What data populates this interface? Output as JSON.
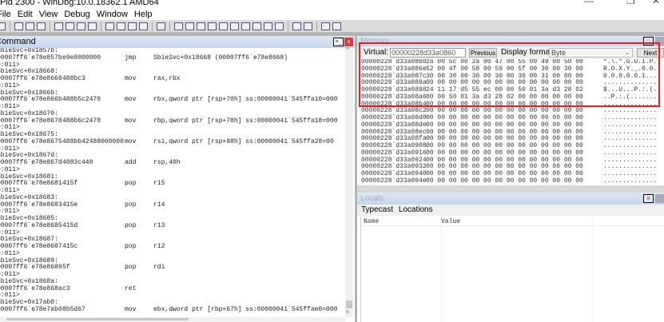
{
  "window": {
    "title": "Pid 2300 - WinDbg:10.0.18362.1 AMD64"
  },
  "menu": [
    "File",
    "Edit",
    "View",
    "Debug",
    "Window",
    "Help"
  ],
  "toolbar_icons": [
    "open-icon",
    "cut-icon",
    "copy-icon",
    "paste-icon",
    "step-into-source-icon",
    "step-over-source-icon",
    "stop-debugging-icon",
    "break-icon",
    "step-into-icon",
    "step-over-icon",
    "step-out-icon",
    "run-to-cursor-icon",
    "hand-icon",
    "command-window-icon",
    "watch-icon",
    "locals-icon",
    "registers-icon",
    "memory-icon",
    "call-stack-icon",
    "disassembly-icon",
    "scratch-pad-icon",
    "processes-icon",
    "command-browser-icon",
    "source-mode-icon",
    "hex-mode-icon",
    "font-icon",
    "options-icon"
  ],
  "command": {
    "title": "Command",
    "lines": [
      {
        "t": "l",
        "a": "SbieSvc+0x1857b:"
      },
      {
        "t": "i",
        "addr": "00007ff6`e78e857b",
        "bytes": "e9e8000000",
        "op": "jmp",
        "args": "SbieSvc+0x18668 (00007ff6`e78e8668)"
      },
      {
        "t": "p",
        "a": "0:011>"
      },
      {
        "t": "l",
        "a": "SbieSvc+0x18668:"
      },
      {
        "t": "i",
        "addr": "00007ff6`e78e8668",
        "bytes": "488bc3",
        "op": "mov",
        "args": "rax,rbx"
      },
      {
        "t": "p",
        "a": "0:011>"
      },
      {
        "t": "l",
        "a": "SbieSvc+0x1866b:"
      },
      {
        "t": "i",
        "addr": "00007ff6`e78e866b",
        "bytes": "488b5c2470",
        "op": "mov",
        "args": "rbx,qword ptr [rsp+70h] ss:00000041`545ffa10=000"
      },
      {
        "t": "p",
        "a": "0:011>"
      },
      {
        "t": "l",
        "a": "SbieSvc+0x18670:"
      },
      {
        "t": "i",
        "addr": "00007ff6`e78e8670",
        "bytes": "488b6c2478",
        "op": "mov",
        "args": "rbp,qword ptr [rsp+78h] ss:00000041`545ffa18=000"
      },
      {
        "t": "p",
        "a": "0:011>"
      },
      {
        "t": "l",
        "a": "SbieSvc+0x18675:"
      },
      {
        "t": "i",
        "addr": "00007ff6`e78e8675",
        "bytes": "488bb42488000000",
        "op": "mov",
        "args": " rsi,qword ptr [rsp+88h] ss:00000041`545ffa28=00"
      },
      {
        "t": "p",
        "a": "0:011>"
      },
      {
        "t": "l",
        "a": "SbieSvc+0x1867d:"
      },
      {
        "t": "i",
        "addr": "00007ff6`e78e867d",
        "bytes": "4883c440",
        "op": "add",
        "args": "rsp,40h"
      },
      {
        "t": "p",
        "a": "0:011>"
      },
      {
        "t": "l",
        "a": "SbieSvc+0x18681:"
      },
      {
        "t": "i",
        "addr": "00007ff6`e78e8681",
        "bytes": "415f",
        "op": "pop",
        "args": "r15"
      },
      {
        "t": "p",
        "a": "0:011>"
      },
      {
        "t": "l",
        "a": "SbieSvc+0x18683:"
      },
      {
        "t": "i",
        "addr": "00007ff6`e78e8683",
        "bytes": "415e",
        "op": "pop",
        "args": "r14"
      },
      {
        "t": "p",
        "a": "0:011>"
      },
      {
        "t": "l",
        "a": "SbieSvc+0x18685:"
      },
      {
        "t": "i",
        "addr": "00007ff6`e78e8685",
        "bytes": "415d",
        "op": "pop",
        "args": "r13"
      },
      {
        "t": "p",
        "a": "0:011>"
      },
      {
        "t": "l",
        "a": "SbieSvc+0x18687:"
      },
      {
        "t": "i",
        "addr": "00007ff6`e78e8687",
        "bytes": "415c",
        "op": "pop",
        "args": "r12"
      },
      {
        "t": "p",
        "a": "0:011>"
      },
      {
        "t": "l",
        "a": "SbieSvc+0x18689:"
      },
      {
        "t": "i",
        "addr": "00007ff6`e78e8689",
        "bytes": "5f",
        "op": "pop",
        "args": "rdi"
      },
      {
        "t": "p",
        "a": "0:011>"
      },
      {
        "t": "l",
        "a": "SbieSvc+0x1868a:"
      },
      {
        "t": "i",
        "addr": "00007ff6`e78e868a",
        "bytes": "c3",
        "op": "ret",
        "args": ""
      },
      {
        "t": "p",
        "a": "0:011>"
      },
      {
        "t": "l",
        "a": "SbieSvc+0x17ab0:"
      },
      {
        "t": "i",
        "addr": "00007ff6`e78e7ab0",
        "bytes": "8b5d67",
        "op": "mov",
        "args": "ebx,dword ptr [rbp+67h] ss:00000041`545ffae0=000"
      }
    ]
  },
  "memory": {
    "title": "Memory",
    "virtual_label": "Virtual:",
    "virtual_value": "00000228d33a0860",
    "previous_label": "Previous",
    "format_label": "Display format:",
    "format_value": "Byte",
    "next_label": "Next",
    "rows": [
      {
        "addr": "00000228`d33a0860",
        "hex": "2a 00 5c 00 2a 00 47 00 55 00 49 00 50 00",
        "ascii": "*.\\.*.G.U.I.P."
      },
      {
        "addr": "00000228`d33a086e",
        "hex": "52 00 4f 00 58 00 59 00 5f 00 30 00 30 00",
        "ascii": "R.O.X.Y._.0.0."
      },
      {
        "addr": "00000228`d33a087c",
        "hex": "30 00 30 00 30 00 30 00 30 00 31 00 00 00",
        "ascii": "0.0.0.0.0.1..."
      },
      {
        "addr": "00000228`d33a088a",
        "hex": "00 00 00 00 00 00 00 00 00 00 00 00 00 00",
        "ascii": ".............."
      },
      {
        "addr": "00000228`d33a0898",
        "hex": "24 11 17 d5 55 ec 00 00 50 01 3a d3 28 02",
        "ascii": "$...U...P.:.(."
      },
      {
        "addr": "00000228`d33a08a6",
        "hex": "00 00 50 01 3a d3 28 02 00 00 00 00 00 00",
        "ascii": "..P.:.(......."
      },
      {
        "addr": "00000228`d33a08b4",
        "hex": "00 00 00 00 00 00 00 00 00 00 00 00 00 00",
        "ascii": ".............."
      },
      {
        "addr": "00000228`d33a08c2",
        "hex": "00 00 00 00 00 00 00 00 00 00 00 00 00 00",
        "ascii": ".............."
      },
      {
        "addr": "00000228`d33a08d0",
        "hex": "00 00 00 00 00 00 00 00 00 00 00 00 00 00",
        "ascii": ".............."
      },
      {
        "addr": "00000228`d33a08de",
        "hex": "00 00 00 00 00 00 00 00 00 00 00 00 00 00",
        "ascii": ".............."
      },
      {
        "addr": "00000228`d33a08ec",
        "hex": "00 00 00 00 00 00 00 00 00 00 00 00 00 00",
        "ascii": ".............."
      },
      {
        "addr": "00000228`d33a08fa",
        "hex": "00 00 00 00 00 00 00 00 00 00 00 00 00 00",
        "ascii": ".............."
      },
      {
        "addr": "00000228`d33a0908",
        "hex": "00 00 00 00 00 00 00 00 00 00 00 00 00 00",
        "ascii": ".............."
      },
      {
        "addr": "00000228`d33a0916",
        "hex": "00 00 00 00 00 00 00 00 00 00 00 00 00 00",
        "ascii": ".............."
      },
      {
        "addr": "00000228`d33a0924",
        "hex": "00 00 00 00 00 00 00 00 00 00 00 00 00 00",
        "ascii": ".............."
      },
      {
        "addr": "00000228`d33a0932",
        "hex": "00 00 00 00 00 00 00 00 00 00 00 00 00 00",
        "ascii": ".............."
      },
      {
        "addr": "00000228`d33a0940",
        "hex": "00 00 00 00 00 00 00 00 00 00 00 00 00 00",
        "ascii": ".............."
      },
      {
        "addr": "00000228`d33a094e",
        "hex": "00 00 00 00 00 00 00 00 00 00 00 00 00 00",
        "ascii": ".............."
      }
    ]
  },
  "locals": {
    "title": "Locals",
    "typecast_label": "Typecast",
    "locations_label": "Locations",
    "col_name": "Name",
    "col_value": "Value"
  },
  "colors": {
    "highlight": "#f01c1c",
    "panel_header": "#c4d6ec"
  }
}
